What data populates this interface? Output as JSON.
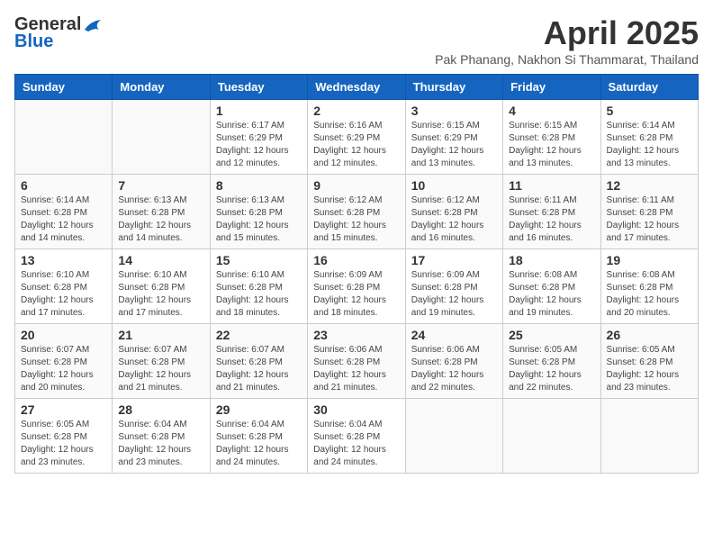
{
  "logo": {
    "text_general": "General",
    "text_blue": "Blue"
  },
  "title": "April 2025",
  "location": "Pak Phanang, Nakhon Si Thammarat, Thailand",
  "weekdays": [
    "Sunday",
    "Monday",
    "Tuesday",
    "Wednesday",
    "Thursday",
    "Friday",
    "Saturday"
  ],
  "weeks": [
    [
      {
        "day": "",
        "info": ""
      },
      {
        "day": "",
        "info": ""
      },
      {
        "day": "1",
        "info": "Sunrise: 6:17 AM\nSunset: 6:29 PM\nDaylight: 12 hours\nand 12 minutes."
      },
      {
        "day": "2",
        "info": "Sunrise: 6:16 AM\nSunset: 6:29 PM\nDaylight: 12 hours\nand 12 minutes."
      },
      {
        "day": "3",
        "info": "Sunrise: 6:15 AM\nSunset: 6:29 PM\nDaylight: 12 hours\nand 13 minutes."
      },
      {
        "day": "4",
        "info": "Sunrise: 6:15 AM\nSunset: 6:28 PM\nDaylight: 12 hours\nand 13 minutes."
      },
      {
        "day": "5",
        "info": "Sunrise: 6:14 AM\nSunset: 6:28 PM\nDaylight: 12 hours\nand 13 minutes."
      }
    ],
    [
      {
        "day": "6",
        "info": "Sunrise: 6:14 AM\nSunset: 6:28 PM\nDaylight: 12 hours\nand 14 minutes."
      },
      {
        "day": "7",
        "info": "Sunrise: 6:13 AM\nSunset: 6:28 PM\nDaylight: 12 hours\nand 14 minutes."
      },
      {
        "day": "8",
        "info": "Sunrise: 6:13 AM\nSunset: 6:28 PM\nDaylight: 12 hours\nand 15 minutes."
      },
      {
        "day": "9",
        "info": "Sunrise: 6:12 AM\nSunset: 6:28 PM\nDaylight: 12 hours\nand 15 minutes."
      },
      {
        "day": "10",
        "info": "Sunrise: 6:12 AM\nSunset: 6:28 PM\nDaylight: 12 hours\nand 16 minutes."
      },
      {
        "day": "11",
        "info": "Sunrise: 6:11 AM\nSunset: 6:28 PM\nDaylight: 12 hours\nand 16 minutes."
      },
      {
        "day": "12",
        "info": "Sunrise: 6:11 AM\nSunset: 6:28 PM\nDaylight: 12 hours\nand 17 minutes."
      }
    ],
    [
      {
        "day": "13",
        "info": "Sunrise: 6:10 AM\nSunset: 6:28 PM\nDaylight: 12 hours\nand 17 minutes."
      },
      {
        "day": "14",
        "info": "Sunrise: 6:10 AM\nSunset: 6:28 PM\nDaylight: 12 hours\nand 17 minutes."
      },
      {
        "day": "15",
        "info": "Sunrise: 6:10 AM\nSunset: 6:28 PM\nDaylight: 12 hours\nand 18 minutes."
      },
      {
        "day": "16",
        "info": "Sunrise: 6:09 AM\nSunset: 6:28 PM\nDaylight: 12 hours\nand 18 minutes."
      },
      {
        "day": "17",
        "info": "Sunrise: 6:09 AM\nSunset: 6:28 PM\nDaylight: 12 hours\nand 19 minutes."
      },
      {
        "day": "18",
        "info": "Sunrise: 6:08 AM\nSunset: 6:28 PM\nDaylight: 12 hours\nand 19 minutes."
      },
      {
        "day": "19",
        "info": "Sunrise: 6:08 AM\nSunset: 6:28 PM\nDaylight: 12 hours\nand 20 minutes."
      }
    ],
    [
      {
        "day": "20",
        "info": "Sunrise: 6:07 AM\nSunset: 6:28 PM\nDaylight: 12 hours\nand 20 minutes."
      },
      {
        "day": "21",
        "info": "Sunrise: 6:07 AM\nSunset: 6:28 PM\nDaylight: 12 hours\nand 21 minutes."
      },
      {
        "day": "22",
        "info": "Sunrise: 6:07 AM\nSunset: 6:28 PM\nDaylight: 12 hours\nand 21 minutes."
      },
      {
        "day": "23",
        "info": "Sunrise: 6:06 AM\nSunset: 6:28 PM\nDaylight: 12 hours\nand 21 minutes."
      },
      {
        "day": "24",
        "info": "Sunrise: 6:06 AM\nSunset: 6:28 PM\nDaylight: 12 hours\nand 22 minutes."
      },
      {
        "day": "25",
        "info": "Sunrise: 6:05 AM\nSunset: 6:28 PM\nDaylight: 12 hours\nand 22 minutes."
      },
      {
        "day": "26",
        "info": "Sunrise: 6:05 AM\nSunset: 6:28 PM\nDaylight: 12 hours\nand 23 minutes."
      }
    ],
    [
      {
        "day": "27",
        "info": "Sunrise: 6:05 AM\nSunset: 6:28 PM\nDaylight: 12 hours\nand 23 minutes."
      },
      {
        "day": "28",
        "info": "Sunrise: 6:04 AM\nSunset: 6:28 PM\nDaylight: 12 hours\nand 23 minutes."
      },
      {
        "day": "29",
        "info": "Sunrise: 6:04 AM\nSunset: 6:28 PM\nDaylight: 12 hours\nand 24 minutes."
      },
      {
        "day": "30",
        "info": "Sunrise: 6:04 AM\nSunset: 6:28 PM\nDaylight: 12 hours\nand 24 minutes."
      },
      {
        "day": "",
        "info": ""
      },
      {
        "day": "",
        "info": ""
      },
      {
        "day": "",
        "info": ""
      }
    ]
  ]
}
